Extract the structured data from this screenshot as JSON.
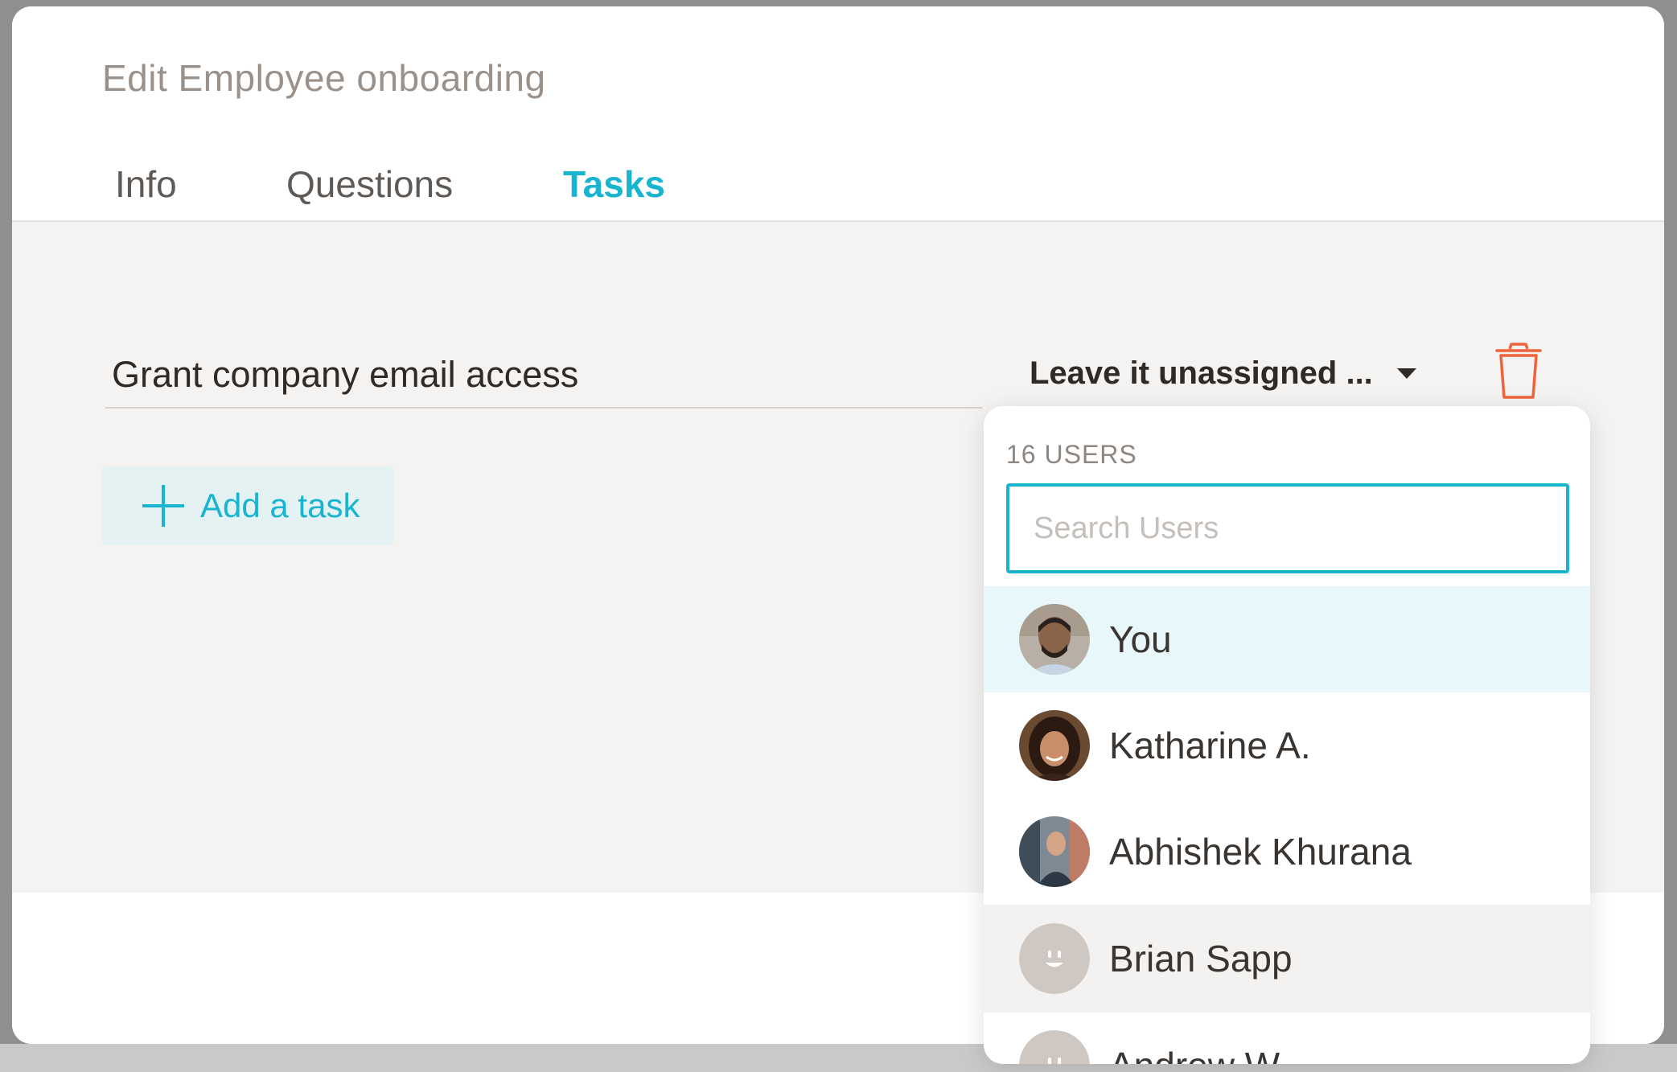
{
  "modal": {
    "title": "Edit Employee onboarding",
    "tabs": [
      {
        "label": "Info",
        "active": false
      },
      {
        "label": "Questions",
        "active": false
      },
      {
        "label": "Tasks",
        "active": true
      }
    ]
  },
  "task": {
    "value": "Grant company email access",
    "assignee_label": "Leave it unassigned ...",
    "delete_icon": "trash-icon"
  },
  "add_task": {
    "label": "Add a task",
    "icon": "plus-icon"
  },
  "user_picker": {
    "count_label": "16 USERS",
    "search_placeholder": "Search Users",
    "users": [
      {
        "name": "You",
        "avatar": "photo"
      },
      {
        "name": "Katharine A.",
        "avatar": "photo"
      },
      {
        "name": "Abhishek Khurana",
        "avatar": "photo"
      },
      {
        "name": "Brian Sapp",
        "avatar": "placeholder-face"
      },
      {
        "name": "Andrew W.",
        "avatar": "placeholder-face"
      }
    ]
  },
  "colors": {
    "accent": "#19b4cf",
    "danger": "#f0643c",
    "selected_row": "#e8f7f9",
    "body_bg": "#f4f3f1"
  }
}
